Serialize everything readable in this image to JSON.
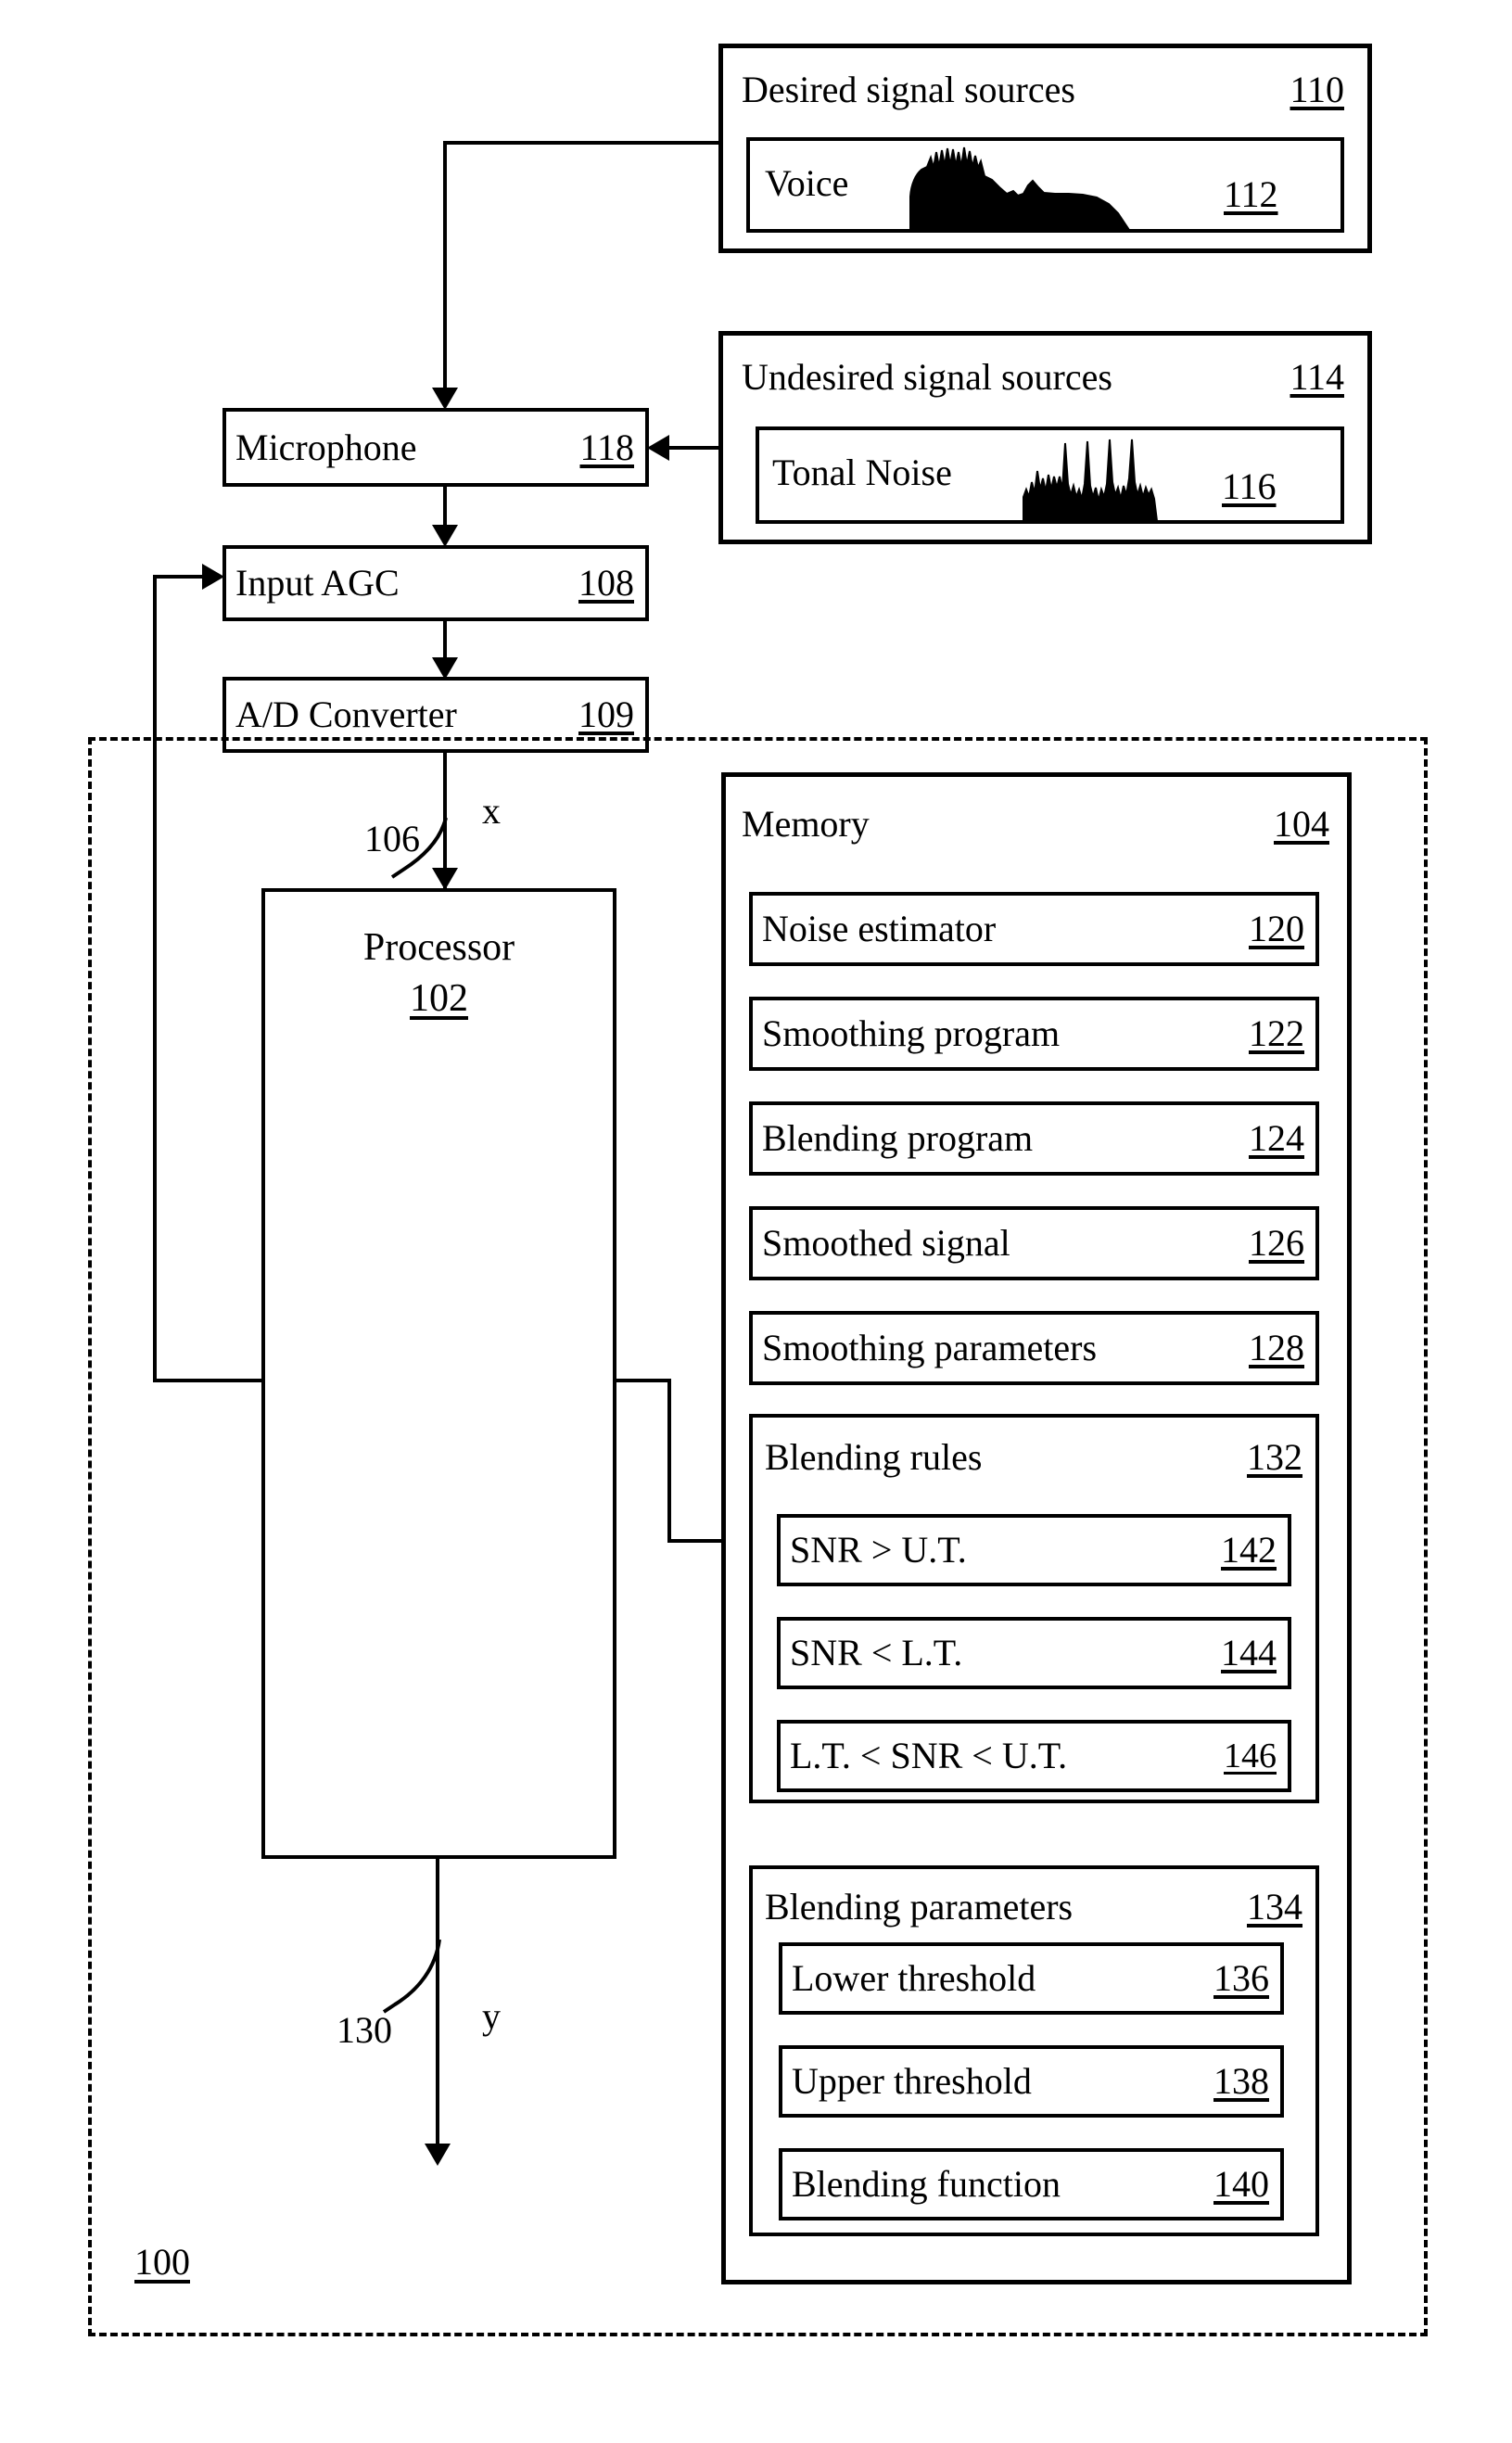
{
  "figure": {
    "system_ref": "100",
    "signal_in_label": "x",
    "signal_in_ref": "106",
    "signal_out_label": "y",
    "signal_out_ref": "130"
  },
  "desired_sources": {
    "title": "Desired signal sources",
    "ref": "110",
    "item": {
      "label": "Voice",
      "ref": "112",
      "waveform": "voice-spectrum"
    }
  },
  "undesired_sources": {
    "title": "Undesired signal sources",
    "ref": "114",
    "item": {
      "label": "Tonal Noise",
      "ref": "116",
      "waveform": "tonal-noise-spectrum"
    }
  },
  "front_end": [
    {
      "label": "Microphone",
      "ref": "118"
    },
    {
      "label": "Input AGC",
      "ref": "108"
    },
    {
      "label": "A/D Converter",
      "ref": "109"
    }
  ],
  "processor": {
    "label": "Processor",
    "ref": "102"
  },
  "memory": {
    "title": "Memory",
    "ref": "104",
    "items": [
      {
        "label": "Noise estimator",
        "ref": "120"
      },
      {
        "label": "Smoothing program",
        "ref": "122"
      },
      {
        "label": "Blending program",
        "ref": "124"
      },
      {
        "label": "Smoothed signal",
        "ref": "126"
      },
      {
        "label": "Smoothing parameters",
        "ref": "128"
      }
    ],
    "blending_rules": {
      "title": "Blending rules",
      "ref": "132",
      "items": [
        {
          "label": "SNR > U.T.",
          "ref": "142"
        },
        {
          "label": "SNR < L.T.",
          "ref": "144"
        },
        {
          "label": "L.T. < SNR < U.T.",
          "ref": "146"
        }
      ]
    },
    "blending_parameters": {
      "title": "Blending parameters",
      "ref": "134",
      "items": [
        {
          "label": "Lower threshold",
          "ref": "136"
        },
        {
          "label": "Upper threshold",
          "ref": "138"
        },
        {
          "label": "Blending function",
          "ref": "140"
        }
      ]
    }
  }
}
